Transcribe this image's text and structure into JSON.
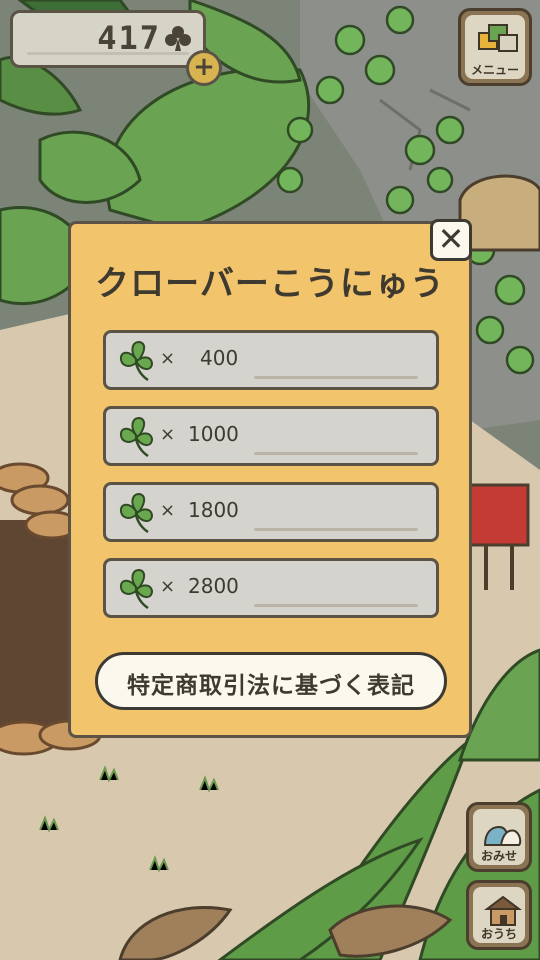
{
  "hud": {
    "clover_count": "417",
    "plus_symbol": "+",
    "menu_label": "メニュー"
  },
  "dialog": {
    "title": "クローバーこうにゅう",
    "close_symbol": "✕",
    "options": [
      {
        "times": "×",
        "amount": "400"
      },
      {
        "times": "×",
        "amount": "1000"
      },
      {
        "times": "×",
        "amount": "1800"
      },
      {
        "times": "×",
        "amount": "2800"
      }
    ],
    "legal_label": "特定商取引法に基づく表記"
  },
  "side_buttons": {
    "shop_label": "おみせ",
    "home_label": "おうち"
  },
  "colors": {
    "dialog_bg": "#f2c46c",
    "option_bg": "#d5d3cd",
    "clover_green": "#6aa84f",
    "outline": "#3d3a33"
  }
}
